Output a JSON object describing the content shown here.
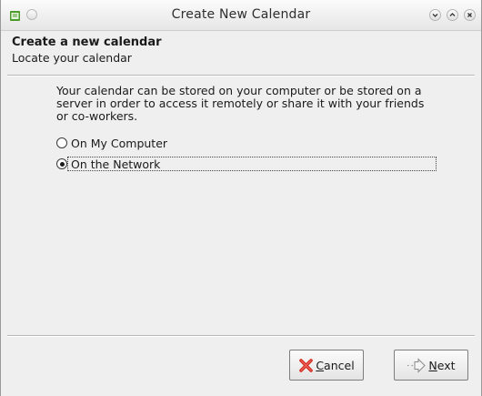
{
  "window": {
    "title": "Create New Calendar"
  },
  "header": {
    "title": "Create a new calendar",
    "subtitle": "Locate your calendar"
  },
  "content": {
    "description": "Your calendar can be stored on your computer or be stored on a server in order to access it remotely or share it with your friends or co-workers.",
    "options": [
      {
        "label": "On My Computer",
        "selected": false
      },
      {
        "label": "On the Network",
        "selected": true
      }
    ]
  },
  "buttons": {
    "cancel": {
      "prefix": "",
      "mnemonic": "C",
      "rest": "ancel"
    },
    "next": {
      "prefix": "",
      "mnemonic": "N",
      "rest": "ext"
    }
  },
  "icons": {
    "app": "calendar-app-icon",
    "menu": "window-menu-icon",
    "minimize": "minimize-icon",
    "maximize": "maximize-icon",
    "close": "close-icon",
    "cancel": "red-x-icon",
    "next": "arrow-right-icon"
  },
  "colors": {
    "cancel_icon": "#d22b20",
    "app_icon": "#4c9a2a"
  }
}
